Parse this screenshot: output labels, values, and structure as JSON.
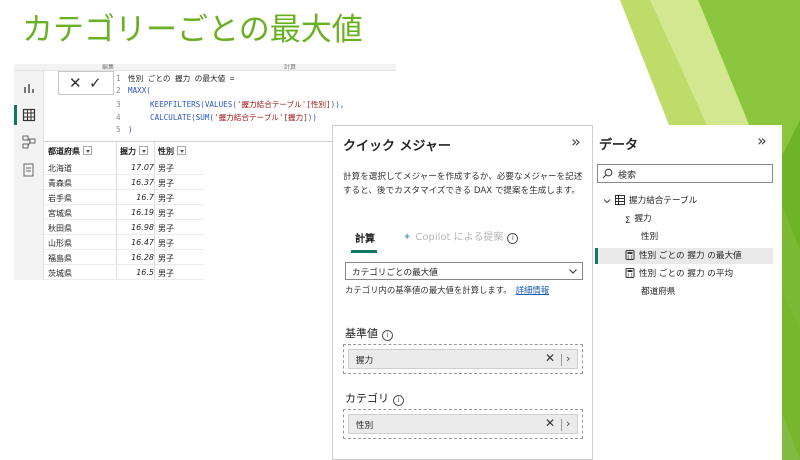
{
  "slide": {
    "title": "カテゴリーごとの最大値"
  },
  "colors": {
    "title_green": "#6ab023",
    "accent_teal": "#117865",
    "keyword_blue": "#2b57c4",
    "string_red": "#a31515"
  },
  "editor": {
    "ribbon_fragments": [
      "編集",
      "計算"
    ],
    "cancel_glyph": "✕",
    "commit_glyph": "✓",
    "formula": [
      {
        "n": "1",
        "text": "性別 ごとの 握力 の最大値 ="
      },
      {
        "n": "2",
        "text": "MAXX("
      },
      {
        "n": "3",
        "fn": "KEEPFILTERS(VALUES(",
        "str": "'握力結合テーブル'[性別]",
        "tail": ")),"
      },
      {
        "n": "4",
        "fn": "CALCULATE(SUM(",
        "str": "'握力結合テーブル'[握力]",
        "tail": "))"
      },
      {
        "n": "5",
        "text": ")"
      }
    ],
    "table": {
      "headers": [
        "都道府県",
        "握力",
        "性別"
      ],
      "rows": [
        {
          "pref": "北海道",
          "val": "17.07",
          "sex": "男子"
        },
        {
          "pref": "青森県",
          "val": "16.37",
          "sex": "男子"
        },
        {
          "pref": "岩手県",
          "val": "16.7",
          "sex": "男子"
        },
        {
          "pref": "宮城県",
          "val": "16.19",
          "sex": "男子"
        },
        {
          "pref": "秋田県",
          "val": "16.98",
          "sex": "男子"
        },
        {
          "pref": "山形県",
          "val": "16.47",
          "sex": "男子"
        },
        {
          "pref": "福島県",
          "val": "16.28",
          "sex": "男子"
        },
        {
          "pref": "茨城県",
          "val": "16.5",
          "sex": "男子"
        }
      ]
    }
  },
  "quick_measure": {
    "title": "クイック メジャー",
    "collapse_glyph": "»",
    "description": "計算を選択してメジャーを作成するか、必要なメジャーを記述すると、後でカスタマイズできる DAX で提案を生成します。",
    "tab_calc": "計算",
    "tab_copilot": "Copilot による提案",
    "calc_value": "カテゴリごとの最大値",
    "calc_description": "カテゴリ内の基準値の最大値を計算します。",
    "details_link": "詳細情報",
    "base_label": "基準値",
    "base_value": "握力",
    "category_label": "カテゴリ",
    "category_value": "性別",
    "clear_glyph": "✕",
    "go_glyph": "›",
    "info_glyph": "i"
  },
  "data_pane": {
    "title": "データ",
    "collapse_glyph": "»",
    "search_placeholder": "検索",
    "table_name": "握力結合テーブル",
    "fields": {
      "grip": "握力",
      "sex": "性別",
      "max_measure": "性別 ごとの 握力 の最大値",
      "avg_measure": "性別 ごとの 握力 の平均",
      "prefecture": "都道府県"
    }
  }
}
